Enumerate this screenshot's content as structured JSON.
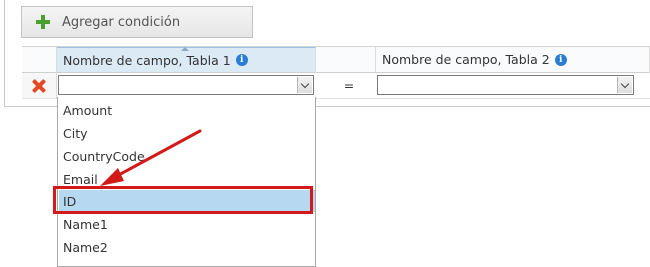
{
  "toolbar": {
    "add_condition_label": "Agregar condición"
  },
  "grid": {
    "headers": [
      {
        "label": "Nombre de campo, Tabla 1"
      },
      {
        "label": "Nombre de campo, Tabla 2"
      }
    ],
    "row": {
      "operator": "="
    }
  },
  "dropdown": {
    "options": [
      "Amount",
      "City",
      "CountryCode",
      "Email",
      "ID",
      "Name1",
      "Name2"
    ],
    "highlighted": "ID"
  },
  "colors": {
    "highlight": "#b6d8f1",
    "annotation": "#d21a1a",
    "accent": "#2a7dd4"
  }
}
